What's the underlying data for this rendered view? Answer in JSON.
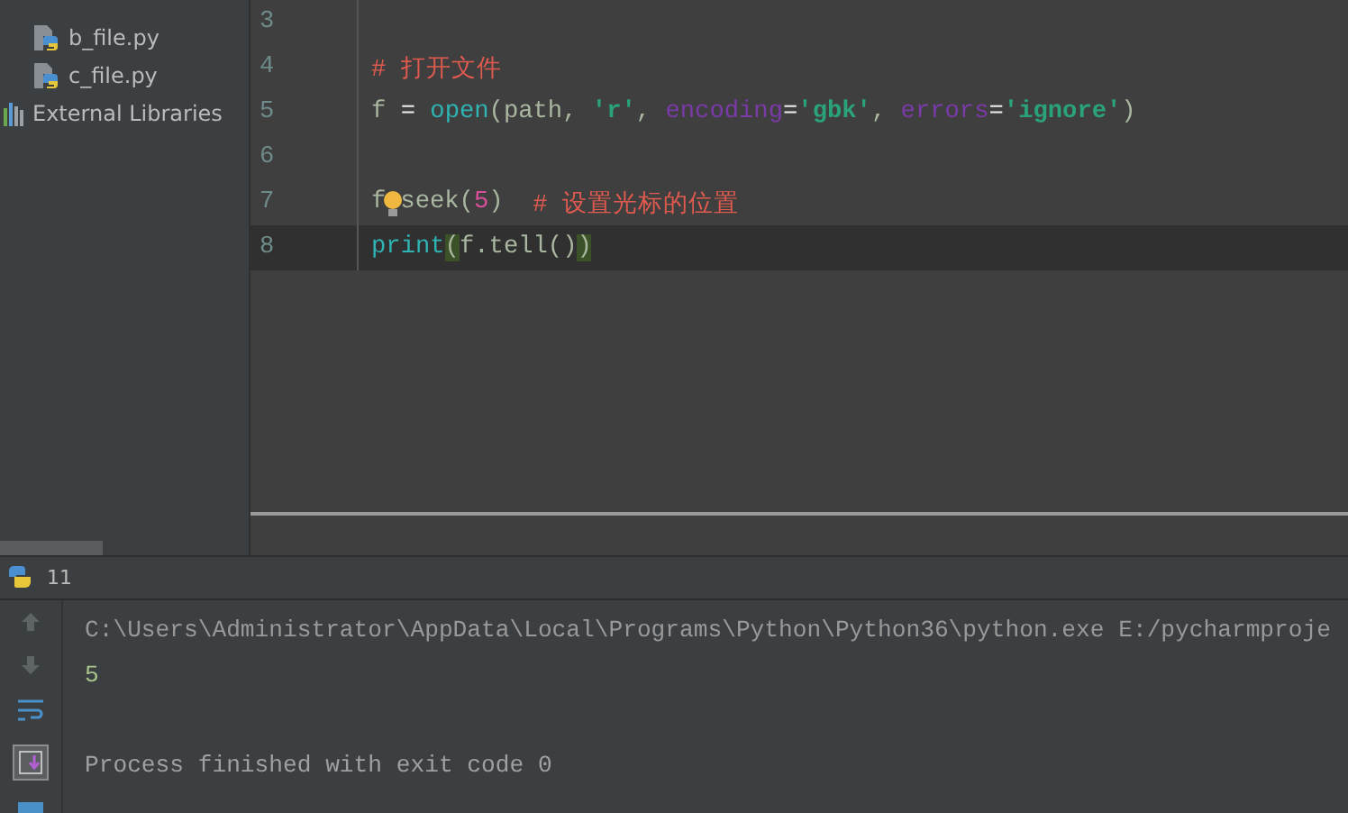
{
  "project_tree": {
    "items": [
      {
        "label": "b_file.py",
        "kind": "python-file"
      },
      {
        "label": "c_file.py",
        "kind": "python-file"
      },
      {
        "label": "External Libraries",
        "kind": "library"
      }
    ]
  },
  "editor": {
    "lines": [
      {
        "number": "3",
        "current": false
      },
      {
        "number": "4",
        "current": false,
        "tokens": [
          {
            "kind": "comment",
            "text": "# 打开文件"
          }
        ]
      },
      {
        "number": "5",
        "current": false,
        "tokens": [
          {
            "kind": "plain",
            "text": "f "
          },
          {
            "kind": "operator",
            "text": "= "
          },
          {
            "kind": "builtin",
            "text": "open"
          },
          {
            "kind": "plain",
            "text": "(path, "
          },
          {
            "kind": "string",
            "text": "'r'"
          },
          {
            "kind": "plain",
            "text": ", "
          },
          {
            "kind": "param",
            "text": "encoding"
          },
          {
            "kind": "operator",
            "text": "="
          },
          {
            "kind": "string",
            "text": "'gbk'"
          },
          {
            "kind": "plain",
            "text": ", "
          },
          {
            "kind": "param",
            "text": "errors"
          },
          {
            "kind": "operator",
            "text": "="
          },
          {
            "kind": "string",
            "text": "'ignore'"
          },
          {
            "kind": "plain",
            "text": ")"
          }
        ]
      },
      {
        "number": "6",
        "current": false
      },
      {
        "number": "7",
        "current": false,
        "tokens": [
          {
            "kind": "plain",
            "text": "f"
          },
          {
            "kind": "bulb"
          },
          {
            "kind": "plain",
            "text": "seek("
          },
          {
            "kind": "number",
            "text": "5"
          },
          {
            "kind": "plain",
            "text": ")  "
          },
          {
            "kind": "comment",
            "text": "# 设置光标的位置"
          }
        ]
      },
      {
        "number": "8",
        "current": true,
        "tokens": [
          {
            "kind": "builtin",
            "text": "print"
          },
          {
            "kind": "match",
            "text": "("
          },
          {
            "kind": "plain",
            "text": "f.tell()"
          },
          {
            "kind": "match",
            "text": ")"
          }
        ]
      }
    ]
  },
  "run_panel": {
    "tab_label": "11",
    "toolbar": [
      {
        "kind": "up"
      },
      {
        "kind": "down"
      },
      {
        "kind": "wrap"
      },
      {
        "kind": "scroll-end"
      },
      {
        "kind": "print"
      }
    ],
    "output": [
      {
        "kind": "command",
        "text": "C:\\Users\\Administrator\\AppData\\Local\\Programs\\Python\\Python36\\python.exe E:/pycharmproje"
      },
      {
        "kind": "output",
        "text": "5"
      },
      {
        "kind": "blank"
      },
      {
        "kind": "system",
        "text": "Process finished with exit code 0"
      }
    ]
  }
}
